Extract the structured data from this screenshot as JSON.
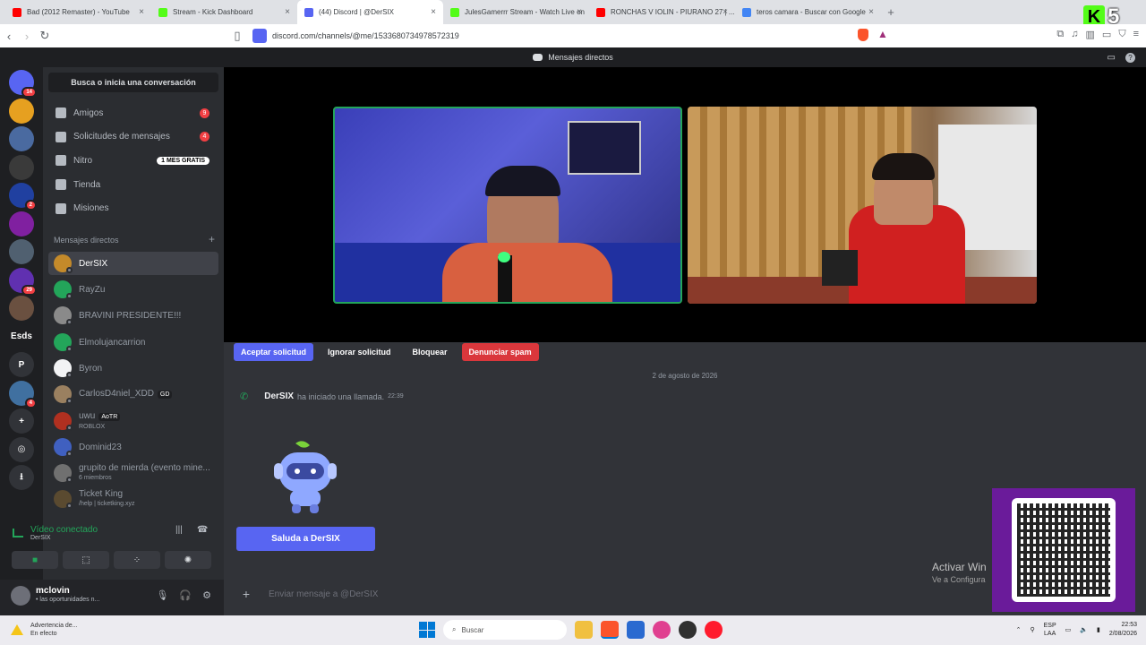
{
  "browser": {
    "tabs": [
      {
        "title": "Bad (2012 Remaster) - YouTube",
        "icon": "youtube-icon",
        "color": "#ff0000"
      },
      {
        "title": "Stream - Kick Dashboard",
        "icon": "kick-icon",
        "color": "#53fc18"
      },
      {
        "title": "(44) Discord | @DerSIX",
        "icon": "discord-icon",
        "color": "#5865f2",
        "active": true
      },
      {
        "title": "JulesGamerrr Stream - Watch Live on",
        "icon": "kick-icon",
        "color": "#53fc18"
      },
      {
        "title": "RONCHAS V IOLIN - PIURANO 27 | ...",
        "icon": "youtube-icon",
        "color": "#ff0000"
      },
      {
        "title": "teros camara - Buscar con Google",
        "icon": "google-icon",
        "color": "#4285f4"
      }
    ],
    "url": "discord.com/channels/@me/1533680734978572319",
    "kick_badge": {
      "letter": "K",
      "number": "5"
    }
  },
  "discord": {
    "top_title": "Mensajes directos",
    "search_label": "Busca o inicia una conversación",
    "nav": [
      {
        "label": "Amigos",
        "count": "9"
      },
      {
        "label": "Solicitudes de mensajes",
        "count": "4"
      },
      {
        "label": "Nitro",
        "promo": "1 MES GRATIS"
      },
      {
        "label": "Tienda"
      },
      {
        "label": "Misiones"
      }
    ],
    "dm_header": "Mensajes directos",
    "dms": [
      {
        "name": "DerSIX",
        "sub": "",
        "tag": "",
        "color": "#c48a2a",
        "selected": true
      },
      {
        "name": "RayZu",
        "sub": "",
        "tag": "",
        "color": "#23a55a"
      },
      {
        "name": "BRAVINI PRESIDENTE!!!",
        "sub": "",
        "tag": "",
        "color": "#8a8a8a"
      },
      {
        "name": "Elmolujancarrion",
        "sub": "",
        "tag": "",
        "color": "#23a55a"
      },
      {
        "name": "Byron",
        "sub": "",
        "tag": "",
        "color": "#f2f3f5"
      },
      {
        "name": "CarlosD4niel_XDD",
        "sub": "",
        "tag": "GD",
        "color": "#9a8060"
      },
      {
        "name": "uwu",
        "sub": "ROBLOX",
        "tag": "AoTR",
        "color": "#b03020"
      },
      {
        "name": "Dominid23",
        "sub": "",
        "tag": "",
        "color": "#4060c0"
      },
      {
        "name": "grupito de mierda (evento mine...",
        "sub": "6 miembros",
        "tag": "",
        "color": "#707070"
      },
      {
        "name": "Ticket King",
        "sub": "/help | ticketking.xyz",
        "tag": "",
        "color": "#5a4a30"
      }
    ],
    "servers": [
      {
        "label": "",
        "badge": "14",
        "color": "#5865f2"
      },
      {
        "label": "",
        "badge": "",
        "color": "#e6a020"
      },
      {
        "label": "",
        "badge": "",
        "color": "#4a6aa0"
      },
      {
        "label": "",
        "badge": "",
        "color": "#3a3a3a"
      },
      {
        "label": "",
        "badge": "2",
        "color": "#2040a0"
      },
      {
        "label": "",
        "badge": "",
        "color": "#8020a0"
      },
      {
        "label": "",
        "badge": "",
        "color": "#506070"
      },
      {
        "label": "",
        "badge": "29",
        "color": "#6030b0"
      },
      {
        "label": "",
        "badge": "",
        "color": "#6a5040"
      },
      {
        "label": "Esds",
        "badge": "",
        "color": "#1e1f22"
      },
      {
        "label": "P",
        "badge": "",
        "color": "#313338"
      },
      {
        "label": "",
        "badge": "4",
        "color": "#4070a0"
      },
      {
        "label": "+",
        "badge": "",
        "color": "#313338"
      },
      {
        "label": "◎",
        "badge": "",
        "color": "#313338"
      },
      {
        "label": "⭳",
        "badge": "",
        "color": "#313338"
      }
    ],
    "voice": {
      "title": "Vídeo conectado",
      "sub": "DerSIX"
    },
    "user": {
      "name": "mclovin",
      "status": "• las oportunidades n..."
    },
    "call_actions": [
      {
        "label": "Aceptar solicitud",
        "style": "primary"
      },
      {
        "label": "Ignorar solicitud",
        "style": "plain"
      },
      {
        "label": "Bloquear",
        "style": "plain"
      },
      {
        "label": "Denunciar spam",
        "style": "danger"
      }
    ],
    "date_separator": "2 de agosto de 2026",
    "call_message": {
      "author": "DerSIX",
      "text": "ha iniciado una llamada.",
      "time": "22:39"
    },
    "wave_button": "Saluda a DerSIX",
    "composer_placeholder": "Enviar mensaje a @DerSIX"
  },
  "overlay": {
    "activate_title": "Activar Win",
    "activate_sub": "Ve a Configura"
  },
  "taskbar": {
    "warning_title": "Advertencia de...",
    "warning_sub": "En efecto",
    "search": "Buscar",
    "lang_top": "ESP",
    "lang_bottom": "LAA",
    "time": "22:53",
    "date": "2/08/2026"
  }
}
